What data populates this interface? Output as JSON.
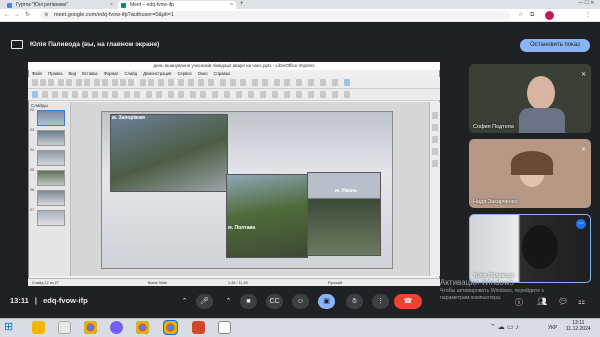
{
  "browser": {
    "tabs": [
      {
        "label": "Гурток \"Юні рятівники\"",
        "active": false
      },
      {
        "label": "Meet – edq-fvow-ifp",
        "active": true
      }
    ],
    "url": "meet.google.com/edq-fvow-ifp?authuser=0&pli=1"
  },
  "banner": {
    "title": "Юлія Паливода (вы, на главном экране)",
    "stop_label": "Остановить показ"
  },
  "libreoffice": {
    "window_title": "день вшанування учасників ліквідації аварії на чаес.pptx - LibreOffice Impress",
    "menu": [
      "Файл",
      "Правка",
      "Вид",
      "Вставка",
      "Формат",
      "Слайд",
      "Демонстрация",
      "Сервис",
      "Окно",
      "Справка"
    ],
    "slides_label": "Слайды",
    "thumb_numbers": [
      "22",
      "23",
      "24",
      "25",
      "26",
      "27"
    ],
    "status_left": "Слайд 22 из 27",
    "status_mid": "Blank Slide",
    "status_coords": "1,45 / 11,49",
    "status_lang": "Русский"
  },
  "slide": {
    "captions": [
      "м. Запоріжжя",
      "м. Полтава",
      "м. Умань"
    ]
  },
  "participants": [
    {
      "name": "София Подтепа",
      "muted": true
    },
    {
      "name": "Надя Захарченко",
      "muted": true
    },
    {
      "name": "Юлія Паливода",
      "muted": false
    }
  ],
  "meeting": {
    "time": "13:11",
    "code": "edq-fvow-ifp"
  },
  "watermark": {
    "title": "Активация Windows",
    "line1": "Чтобы активировать Windows, перейдите к",
    "line2": "параметрам компьютера."
  },
  "taskbar": {
    "lang": "УКР",
    "time": "13:11",
    "date": "11.12.2024"
  },
  "colors": {
    "meet_bg": "#202124",
    "end_call": "#ea4335",
    "accent": "#8ab4f8"
  }
}
